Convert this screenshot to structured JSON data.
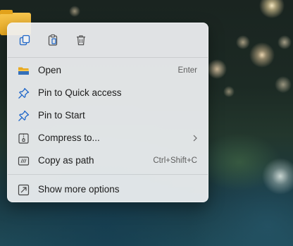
{
  "toolbar": {
    "copy_icon": "copy-icon",
    "paste_icon": "paste-icon",
    "delete_icon": "delete-icon"
  },
  "menu": {
    "items": [
      {
        "label": "Open",
        "accelerator": "Enter",
        "icon": "folder-open-icon"
      },
      {
        "label": "Pin to Quick access",
        "accelerator": "",
        "icon": "pin-icon"
      },
      {
        "label": "Pin to Start",
        "accelerator": "",
        "icon": "pin-icon"
      },
      {
        "label": "Compress to...",
        "accelerator": "",
        "icon": "zip-icon",
        "submenu": true
      },
      {
        "label": "Copy as path",
        "accelerator": "Ctrl+Shift+C",
        "icon": "copy-path-icon"
      }
    ],
    "more_options": {
      "label": "Show more options",
      "icon": "show-more-icon"
    }
  },
  "colors": {
    "accent_blue": "#1e66c8",
    "menu_background": "#eff1f3",
    "text": "#1b1b1b",
    "secondary_text": "#5e5e5e"
  }
}
